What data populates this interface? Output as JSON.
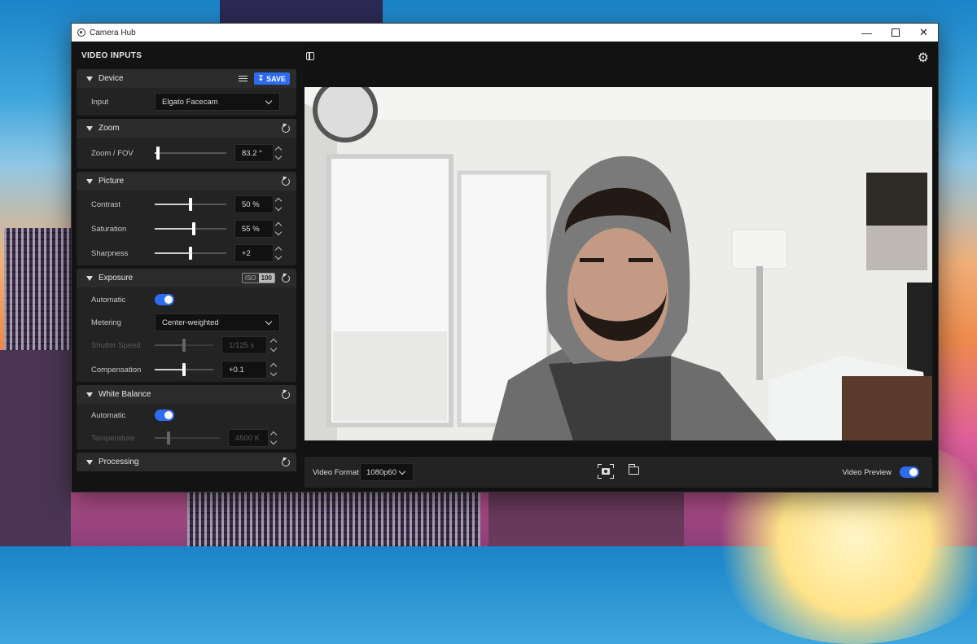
{
  "window": {
    "title": "Camera Hub"
  },
  "left_panel": {
    "header": "VIDEO INPUTS",
    "device": {
      "title": "Device",
      "save_label": "SAVE",
      "input_label": "Input",
      "input_value": "Elgato Facecam"
    },
    "zoom": {
      "title": "Zoom",
      "label": "Zoom / FOV",
      "value": "83.2 °",
      "level": 0.02
    },
    "picture": {
      "title": "Picture",
      "contrast": {
        "label": "Contrast",
        "value": "50 %",
        "level": 0.5
      },
      "saturation": {
        "label": "Saturation",
        "value": "55 %",
        "level": 0.55
      },
      "sharpness": {
        "label": "Sharpness",
        "value": "+2",
        "level": 0.5
      }
    },
    "exposure": {
      "title": "Exposure",
      "iso_key": "ISO",
      "iso_value": "100",
      "automatic_label": "Automatic",
      "metering_label": "Metering",
      "metering_value": "Center-weighted",
      "shutter": {
        "label": "Shutter Speed",
        "value": "1/125 s",
        "level": 0.5
      },
      "compensation": {
        "label": "Compensation",
        "value": "+0.1",
        "level": 0.5
      }
    },
    "white_balance": {
      "title": "White Balance",
      "automatic_label": "Automatic",
      "temperature": {
        "label": "Temperature",
        "value": "4500 K",
        "level": 0.2
      }
    },
    "processing": {
      "title": "Processing"
    }
  },
  "bottom_bar": {
    "video_format_label": "Video Format",
    "video_format_value": "1080p60",
    "video_preview_label": "Video Preview"
  },
  "colors": {
    "accent": "#2d6cf0",
    "panel": "#232323",
    "background": "#131313"
  }
}
